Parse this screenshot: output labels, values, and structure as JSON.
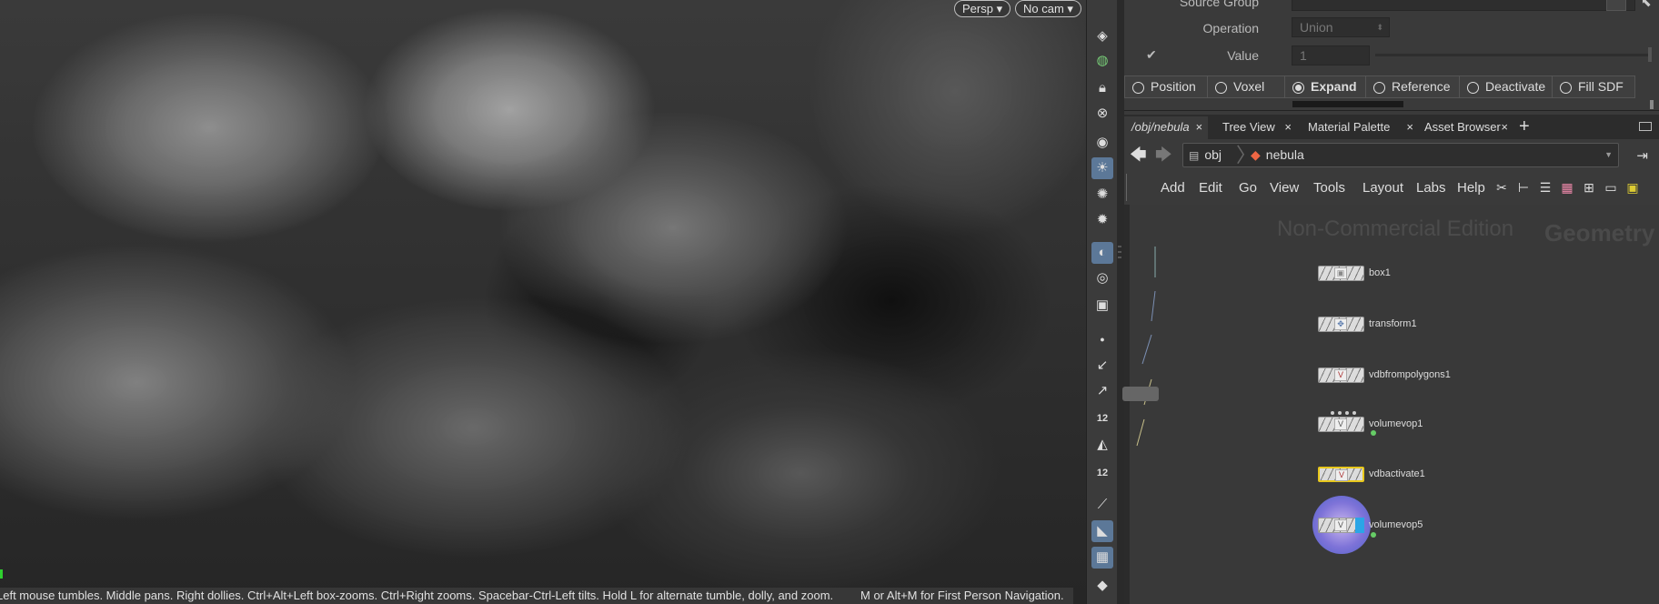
{
  "viewport": {
    "persp_label": "Persp",
    "cam_label": "No cam",
    "status_text": "Left mouse tumbles. Middle pans. Right dollies. Ctrl+Alt+Left box-zooms. Ctrl+Right zooms. Spacebar-Ctrl-Left tilts. Hold L for alternate tumble, dolly, and zoom.",
    "nav_hint": "M or Alt+M for First Person Navigation."
  },
  "toolstrip": {
    "count_a": "12",
    "count_b": "12"
  },
  "params": {
    "source_group_label": "Source Group",
    "operation_label": "Operation",
    "operation_value": "Union",
    "value_label": "Value",
    "value_value": "1",
    "radios": [
      {
        "label": "Position",
        "selected": false
      },
      {
        "label": "Voxel",
        "selected": false
      },
      {
        "label": "Expand",
        "selected": true
      },
      {
        "label": "Reference",
        "selected": false
      },
      {
        "label": "Deactivate",
        "selected": false
      },
      {
        "label": "Fill SDF",
        "selected": false
      }
    ]
  },
  "tabs": [
    {
      "label": "/obj/nebula",
      "active": true
    },
    {
      "label": "Tree View",
      "active": false
    },
    {
      "label": "Material Palette",
      "active": false
    },
    {
      "label": "Asset Browser",
      "active": false
    }
  ],
  "path": {
    "segment_obj": "obj",
    "segment_nebula": "nebula"
  },
  "menus": [
    "Add",
    "Edit",
    "Go",
    "View",
    "Tools",
    "Layout",
    "Labs",
    "Help"
  ],
  "network": {
    "watermark": "Non-Commercial Edition",
    "context_label": "Geometry",
    "nodes": [
      "box1",
      "transform1",
      "vdbfrompolygons1",
      "volumevop1",
      "vdbactivate1",
      "volumevop5"
    ]
  },
  "colors": {
    "highlight": "#5c7898",
    "selected_node": "#e8c81c",
    "display_flag": "#2ba5e6",
    "volumevop5_ring": "#5b6fd6"
  }
}
